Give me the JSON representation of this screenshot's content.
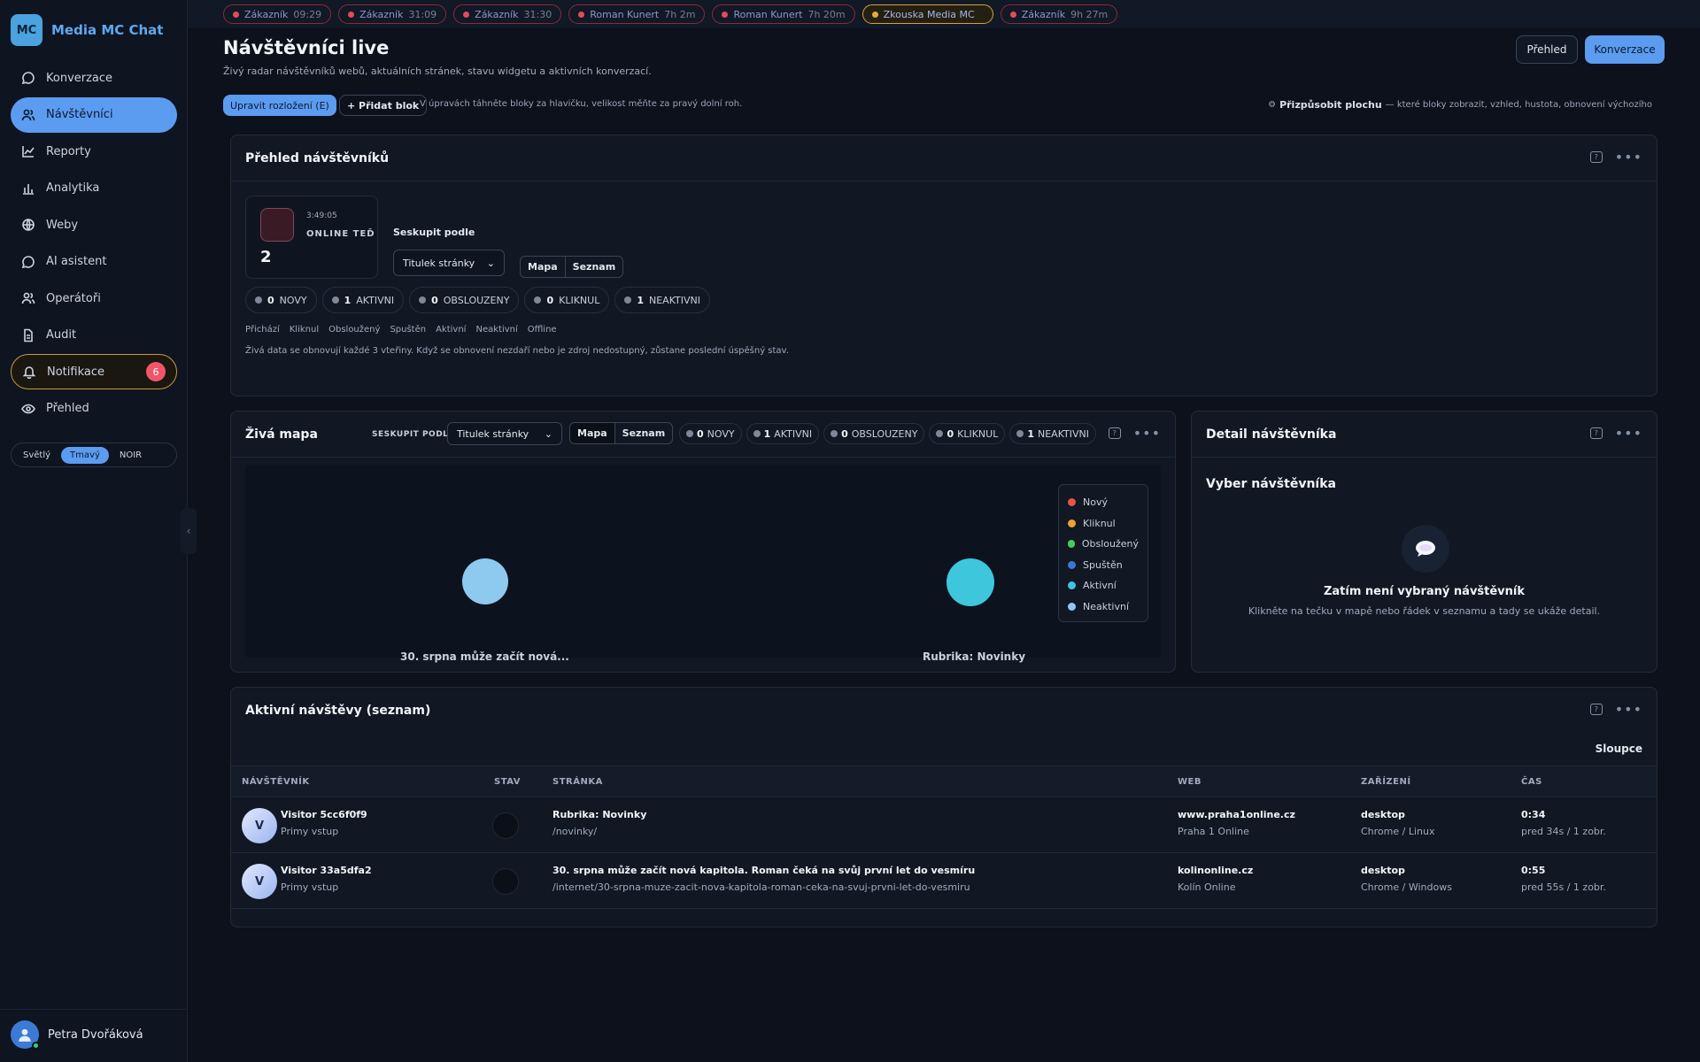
{
  "brand": {
    "logo": "MC",
    "name": "Media MC Chat"
  },
  "nav": [
    {
      "label": "Konverzace",
      "icon": "chat-icon",
      "name": "nav-konverzace"
    },
    {
      "label": "Návštěvníci",
      "icon": "users-icon",
      "name": "nav-navstevnici",
      "active": true
    },
    {
      "label": "Reporty",
      "icon": "line-chart-icon",
      "name": "nav-reporty"
    },
    {
      "label": "Analytika",
      "icon": "bar-chart-icon",
      "name": "nav-analytika"
    },
    {
      "label": "Weby",
      "icon": "globe-icon",
      "name": "nav-weby"
    },
    {
      "label": "AI asistent",
      "icon": "chat-icon",
      "name": "nav-ai-asistent"
    },
    {
      "label": "Operátoři",
      "icon": "users-icon",
      "name": "nav-operatori"
    },
    {
      "label": "Audit",
      "icon": "document-icon",
      "name": "nav-audit"
    },
    {
      "label": "Notifikace",
      "icon": "bell-icon",
      "name": "nav-notifikace",
      "badge": "6"
    },
    {
      "label": "Přehled",
      "icon": "eye-icon",
      "name": "nav-prehled"
    }
  ],
  "theme": {
    "options": [
      "Světlý",
      "Tmavý",
      "NOIR"
    ],
    "selected": "Tmavý"
  },
  "user": {
    "name": "Petra Dvořáková",
    "status_color": "#3ccf6e"
  },
  "tabs": [
    {
      "name": "Zákazník",
      "time": "09:29"
    },
    {
      "name": "Zákazník",
      "time": "31:09"
    },
    {
      "name": "Zákazník",
      "time": "31:30"
    },
    {
      "name": "Roman Kunert",
      "time": "7h 2m"
    },
    {
      "name": "Roman Kunert",
      "time": "7h 20m"
    },
    {
      "name": "Zkouska Media MC",
      "time": "",
      "highlight": true
    },
    {
      "name": "Zákazník",
      "time": "9h 27m"
    }
  ],
  "page": {
    "title": "Návštěvníci live",
    "subtitle": "Živý radar návštěvníků webů, aktuálních stránek, stavu widgetu a aktivních konverzací.",
    "btn_prehled": "Přehled",
    "btn_konverzace": "Konverzace",
    "btn_layout": "Upravit rozložení (E)",
    "btn_add": "+ Přidat blok",
    "hint": "V úpravách táhněte bloky za hlavičku, velikost měňte za pravý dolní roh.",
    "customize_label": "Přizpůsobit plochu",
    "customize_desc": "— které bloky zobrazit, vzhled, hustota, obnovení výchozího"
  },
  "overview": {
    "title": "Přehled návštěvníků",
    "online_time": "3:49:05",
    "online_label": "ONLINE TEĎ",
    "online_count": "2",
    "group_label": "Seskupit podle",
    "group_value": "Titulek stránky",
    "view_map": "Mapa",
    "view_list": "Seznam",
    "states": [
      {
        "count": "0",
        "label": "NOVY"
      },
      {
        "count": "1",
        "label": "AKTIVNI"
      },
      {
        "count": "0",
        "label": "OBSLOUZENY"
      },
      {
        "count": "0",
        "label": "KLIKNUL"
      },
      {
        "count": "1",
        "label": "NEAKTIVNI"
      }
    ],
    "legend_words": [
      "Přichází",
      "Kliknul",
      "Obsloužený",
      "Spuštěn",
      "Aktivní",
      "Neaktivní",
      "Offline"
    ],
    "note": "Živá data se obnovují každé 3 vteřiny. Když se obnovení nezdaří nebo je zdroj nedostupný, zůstane poslední úspěšný stav."
  },
  "map": {
    "title": "Živá mapa",
    "group_label": "SESKUPIT PODLE",
    "group_value": "Titulek stránky",
    "view_map": "Mapa",
    "view_list": "Seznam",
    "states": [
      {
        "count": "0",
        "label": "NOVY"
      },
      {
        "count": "1",
        "label": "AKTIVNI"
      },
      {
        "count": "0",
        "label": "OBSLOUZENY"
      },
      {
        "count": "0",
        "label": "KLIKNUL"
      },
      {
        "count": "1",
        "label": "NEAKTIVNI"
      }
    ],
    "clusters": [
      {
        "label": "30. srpna může začít nová...",
        "color": "#8ecaf0"
      },
      {
        "label": "Rubrika: Novinky",
        "color": "#3ec6dc"
      }
    ],
    "legend": [
      {
        "label": "Nový",
        "color": "#e8534a"
      },
      {
        "label": "Kliknul",
        "color": "#f0a030"
      },
      {
        "label": "Obsloužený",
        "color": "#4cc85a"
      },
      {
        "label": "Spuštěn",
        "color": "#3a78d8"
      },
      {
        "label": "Aktivní",
        "color": "#3ec6dc"
      },
      {
        "label": "Neaktivní",
        "color": "#8ecaf0"
      }
    ]
  },
  "detail": {
    "title": "Detail návštěvníka",
    "heading": "Vyber návštěvníka",
    "empty_title": "Zatím není vybraný návštěvník",
    "empty_desc": "Klikněte na tečku v mapě nebo řádek v seznamu a tady se ukáže detail."
  },
  "list": {
    "title": "Aktivní návštěvy (seznam)",
    "columns_btn": "Sloupce",
    "headers": [
      "NÁVŠTĚVNÍK",
      "STAV",
      "STRÁNKA",
      "WEB",
      "ZAŘÍZENÍ",
      "ČAS"
    ],
    "rows": [
      {
        "avatar": "V",
        "visitor": "Visitor 5cc6f0f9",
        "source": "Primy vstup",
        "page_title": "Rubrika: Novinky",
        "page_path": "/novinky/",
        "web": "www.praha1online.cz",
        "web_name": "Praha 1 Online",
        "device": "desktop",
        "browser": "Chrome / Linux",
        "time": "0:34",
        "time_ago": "pred 34s / 1 zobr."
      },
      {
        "avatar": "V",
        "visitor": "Visitor 33a5dfa2",
        "source": "Primy vstup",
        "page_title": "30. srpna může začít nová kapitola. Roman čeká na svůj první let do vesmíru",
        "page_path": "/internet/30-srpna-muze-zacit-nova-kapitola-roman-ceka-na-svuj-prvni-let-do-vesmiru",
        "web": "kolinonline.cz",
        "web_name": "Kolín Online",
        "device": "desktop",
        "browser": "Chrome / Windows",
        "time": "0:55",
        "time_ago": "pred 55s / 1 zobr."
      }
    ]
  }
}
